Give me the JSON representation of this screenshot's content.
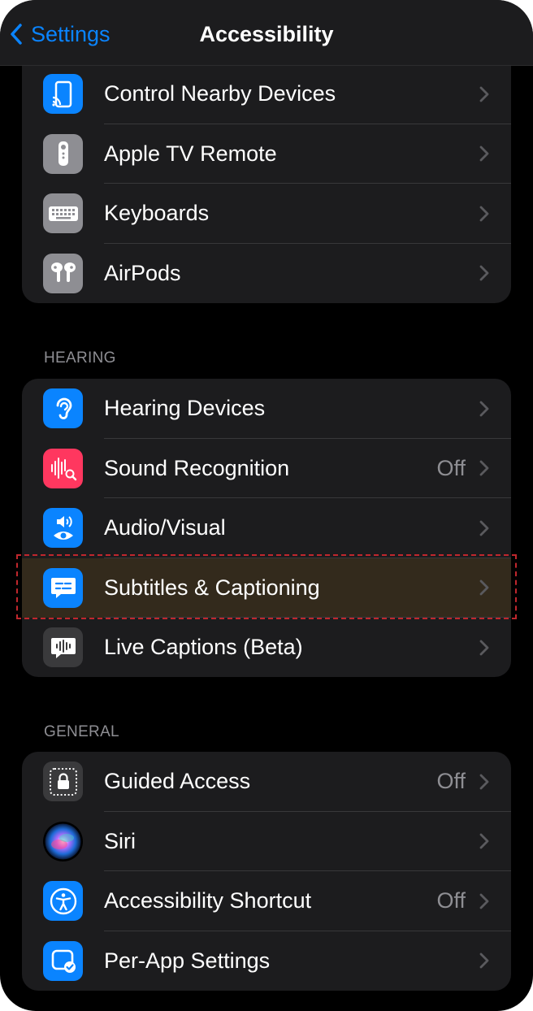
{
  "nav": {
    "back_label": "Settings",
    "title": "Accessibility"
  },
  "group_top": [
    {
      "label": "Control Nearby Devices",
      "icon": "control-nearby-devices-icon",
      "color": "#0a84ff"
    },
    {
      "label": "Apple TV Remote",
      "icon": "tv-remote-icon",
      "color": "#8e8e93"
    },
    {
      "label": "Keyboards",
      "icon": "keyboard-icon",
      "color": "#8e8e93"
    },
    {
      "label": "AirPods",
      "icon": "airpods-icon",
      "color": "#8e8e93"
    }
  ],
  "hearing": {
    "header": "HEARING",
    "items": [
      {
        "label": "Hearing Devices",
        "icon": "ear-icon",
        "color": "#0a84ff"
      },
      {
        "label": "Sound Recognition",
        "value": "Off",
        "icon": "sound-recognition-icon",
        "color": "#ff375f"
      },
      {
        "label": "Audio/Visual",
        "icon": "audio-visual-icon",
        "color": "#0a84ff"
      },
      {
        "label": "Subtitles & Captioning",
        "icon": "subtitles-icon",
        "color": "#0a84ff"
      },
      {
        "label": "Live Captions (Beta)",
        "icon": "live-captions-icon",
        "color": "#3a3a3c"
      }
    ]
  },
  "general": {
    "header": "GENERAL",
    "items": [
      {
        "label": "Guided Access",
        "value": "Off",
        "icon": "guided-access-icon",
        "color": "#3a3a3c"
      },
      {
        "label": "Siri",
        "icon": "siri-icon",
        "color": "#000000"
      },
      {
        "label": "Accessibility Shortcut",
        "value": "Off",
        "icon": "accessibility-icon",
        "color": "#0a84ff"
      },
      {
        "label": "Per-App Settings",
        "icon": "per-app-settings-icon",
        "color": "#0a84ff"
      }
    ]
  }
}
